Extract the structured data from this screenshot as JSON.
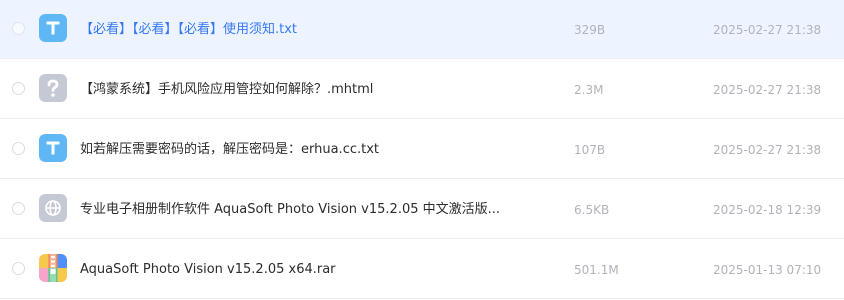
{
  "files": [
    {
      "name": "【必看】【必看】【必看】使用须知.txt",
      "size": "329B",
      "date": "2025-02-27 21:38",
      "icon": "text-file-icon",
      "selected": true
    },
    {
      "name": "【鸿蒙系统】手机风险应用管控如何解除？.mhtml",
      "size": "2.3M",
      "date": "2025-02-27 21:38",
      "icon": "unknown-file-icon",
      "selected": false
    },
    {
      "name": "如若解压需要密码的话，解压密码是：erhua.cc.txt",
      "size": "107B",
      "date": "2025-02-27 21:38",
      "icon": "text-file-icon",
      "selected": false
    },
    {
      "name": "专业电子相册制作软件 AquaSoft Photo Vision v15.2.05 中文激活版....",
      "size": "6.5KB",
      "date": "2025-02-18 12:39",
      "icon": "web-link-file-icon",
      "selected": false
    },
    {
      "name": "AquaSoft Photo Vision v15.2.05 x64.rar",
      "size": "501.1M",
      "date": "2025-01-13 07:10",
      "icon": "archive-file-icon",
      "selected": false
    }
  ],
  "colors": {
    "selected_row_bg": "#eef4ff",
    "selected_text": "#3578f6",
    "text_icon_bg": "#5fb8f5",
    "unknown_icon_bg": "#c5c9d4",
    "meta_text": "#b0b3b9"
  }
}
